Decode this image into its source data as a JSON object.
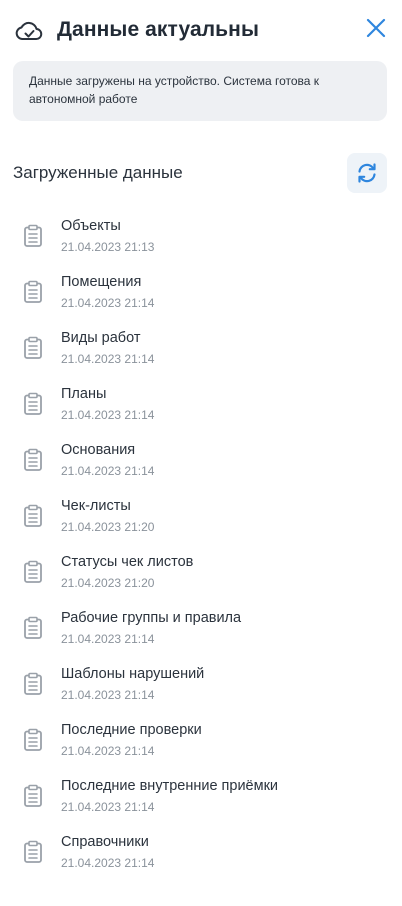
{
  "header": {
    "title": "Данные актуальны",
    "icon": "cloud-check-icon",
    "close_icon": "close-icon"
  },
  "notice": {
    "text": "Данные загружены на устройство. Система готова к автономной работе"
  },
  "section": {
    "title": "Загруженные данные",
    "refresh_icon": "refresh-icon"
  },
  "colors": {
    "accent": "#2f86de",
    "text": "#2b333d",
    "muted": "#8a929b",
    "notice_bg": "#eef0f3"
  },
  "items": [
    {
      "name": "Объекты",
      "date": "21.04.2023 21:13"
    },
    {
      "name": "Помещения",
      "date": "21.04.2023 21:14"
    },
    {
      "name": "Виды работ",
      "date": "21.04.2023 21:14"
    },
    {
      "name": "Планы",
      "date": "21.04.2023 21:14"
    },
    {
      "name": "Основания",
      "date": "21.04.2023 21:14"
    },
    {
      "name": "Чек-листы",
      "date": "21.04.2023 21:20"
    },
    {
      "name": "Статусы чек листов",
      "date": "21.04.2023 21:20"
    },
    {
      "name": "Рабочие группы и правила",
      "date": "21.04.2023 21:14"
    },
    {
      "name": "Шаблоны нарушений",
      "date": "21.04.2023 21:14"
    },
    {
      "name": "Последние проверки",
      "date": "21.04.2023 21:14"
    },
    {
      "name": "Последние внутренние приёмки",
      "date": "21.04.2023 21:14"
    },
    {
      "name": "Справочники",
      "date": "21.04.2023 21:14"
    }
  ]
}
